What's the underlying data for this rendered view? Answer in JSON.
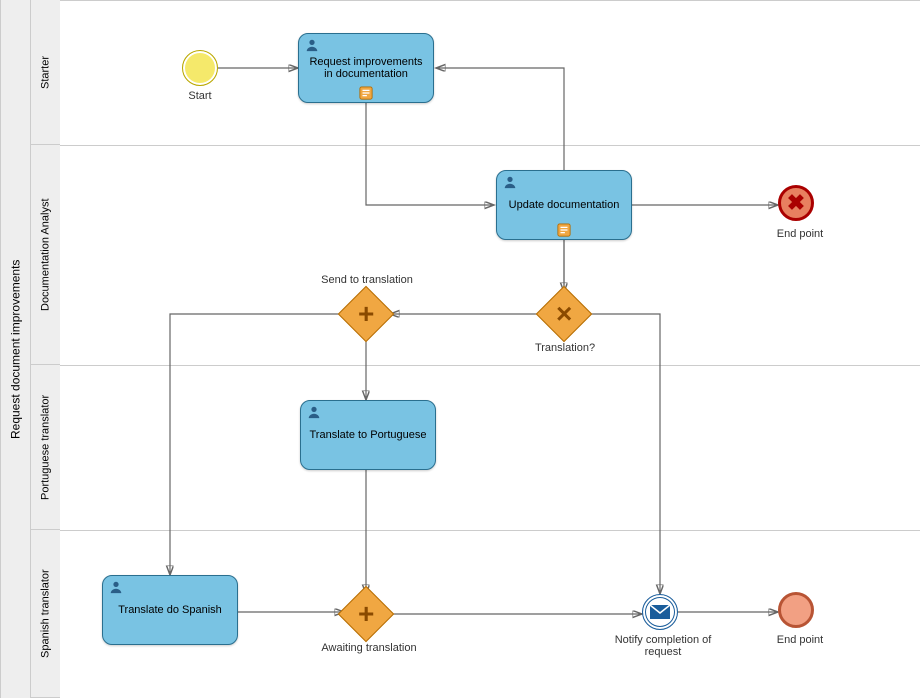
{
  "pool": {
    "title": "Request document improvements"
  },
  "lanes": [
    {
      "title": "Starter"
    },
    {
      "title": "Documentation Analyst"
    },
    {
      "title": "Portuguese translator"
    },
    {
      "title": "Spanish translator"
    }
  ],
  "events": {
    "start": {
      "label": "Start"
    },
    "end_cancel": {
      "label": "End point"
    },
    "end_plain": {
      "label": "End point"
    },
    "notify": {
      "label": "Notify completion of request"
    }
  },
  "tasks": {
    "request_improvements": {
      "label": "Request improvements in documentation"
    },
    "update_doc": {
      "label": "Update documentation"
    },
    "translate_pt": {
      "label": "Translate to Portuguese"
    },
    "translate_es": {
      "label": "Translate do Spanish"
    }
  },
  "gateways": {
    "translation": {
      "label": "Translation?"
    },
    "send_translation": {
      "label": "Send to translation"
    },
    "awaiting": {
      "label": "Awaiting translation"
    }
  }
}
